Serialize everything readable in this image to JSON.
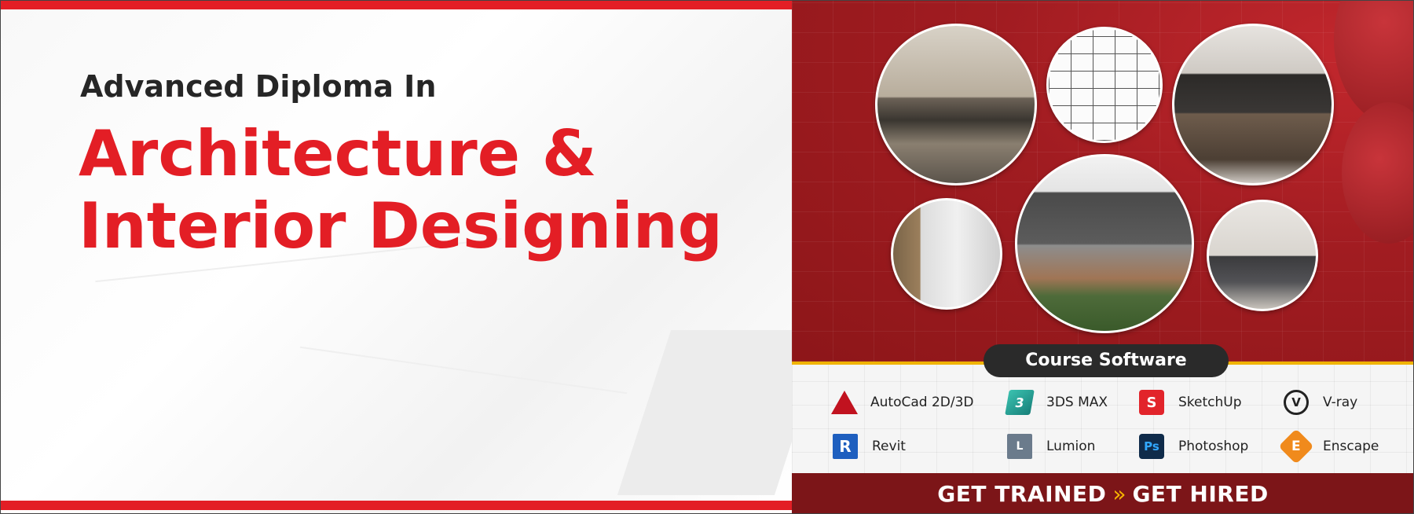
{
  "banner": {
    "subtitle": "Advanced Diploma In",
    "title_line1": "Architecture &",
    "title_line2": "Interior Designing"
  },
  "software_section": {
    "heading": "Course Software",
    "items": [
      {
        "label": "AutoCad 2D/3D",
        "icon": "autocad-icon"
      },
      {
        "label": "3DS MAX",
        "icon": "3ds-max-icon"
      },
      {
        "label": "SketchUp",
        "icon": "sketchup-icon"
      },
      {
        "label": "V-ray",
        "icon": "vray-icon"
      },
      {
        "label": "Revit",
        "icon": "revit-icon"
      },
      {
        "label": "Lumion",
        "icon": "lumion-icon"
      },
      {
        "label": "Photoshop",
        "icon": "photoshop-icon"
      },
      {
        "label": "Enscape",
        "icon": "enscape-icon"
      }
    ]
  },
  "tagline": {
    "left": "GET TRAINED",
    "separator": "»",
    "right": "GET HIRED"
  },
  "colors": {
    "brand_red": "#e31e25",
    "dark_red": "#7c1518",
    "accent_yellow": "#f7b500",
    "text_dark": "#262626"
  }
}
